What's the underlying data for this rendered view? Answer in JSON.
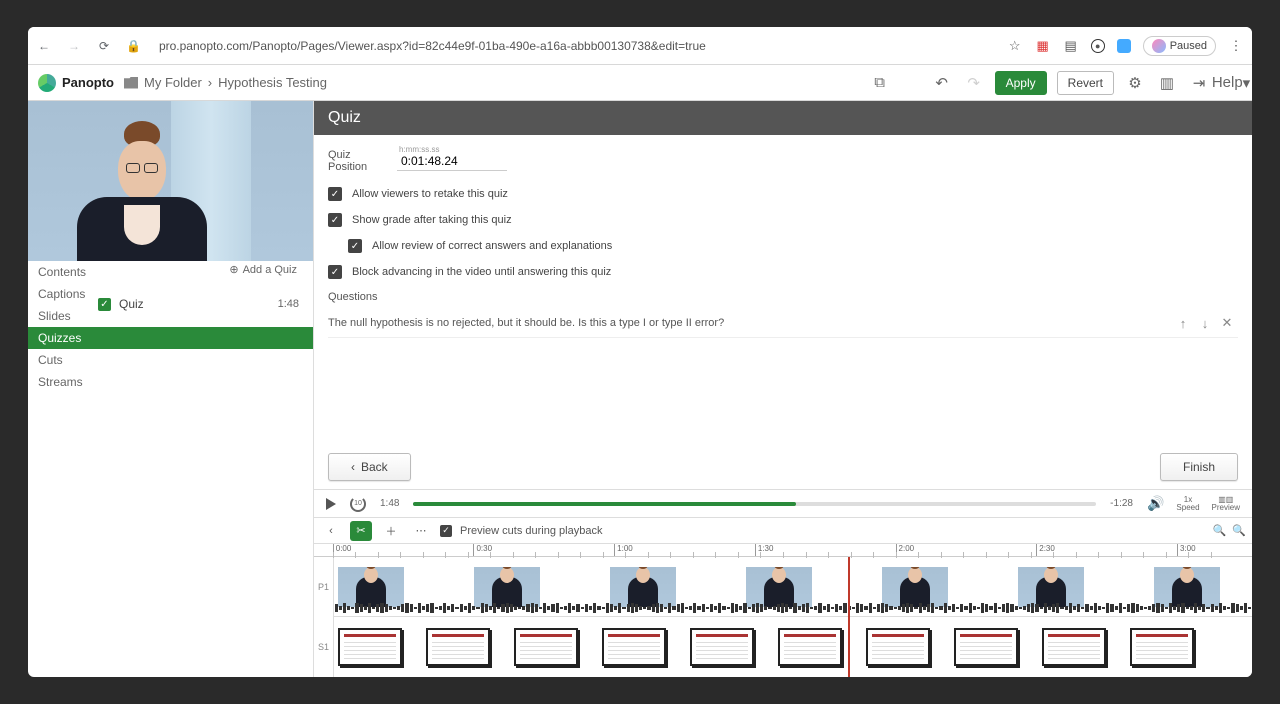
{
  "browser": {
    "url": "pro.panopto.com/Panopto/Pages/Viewer.aspx?id=82c44e9f-01ba-490e-a16a-abbb00130738&edit=true",
    "paused": "Paused"
  },
  "app": {
    "brand": "Panopto",
    "folder": "My Folder",
    "crumb": "Hypothesis Testing",
    "apply": "Apply",
    "revert": "Revert",
    "help": "Help"
  },
  "left": {
    "tabs": [
      "Contents",
      "Captions",
      "Slides",
      "Quizzes",
      "Cuts",
      "Streams"
    ],
    "addquiz": "Add a Quiz",
    "quizitem": {
      "label": "Quiz",
      "time": "1:48"
    }
  },
  "quiz": {
    "title": "Quiz",
    "position_label": "Quiz Position",
    "position_hint": "h:mm:ss.ss",
    "position_value": "0:01:48.24",
    "opt_retake": "Allow viewers to retake this quiz",
    "opt_grade": "Show grade after taking this quiz",
    "opt_review": "Allow review of correct answers and explanations",
    "opt_block": "Block advancing in the video until answering this quiz",
    "questions_hd": "Questions",
    "question1": "The null hypothesis is no rejected, but it should be. Is this a type I or type II error?",
    "back": "Back",
    "finish": "Finish"
  },
  "player": {
    "cur": "1:48",
    "rem": "-1:28",
    "speed": "1x",
    "speed_lbl": "Speed",
    "preview_lbl": "Preview"
  },
  "tltool": {
    "preview_cuts": "Preview cuts during playback"
  },
  "ruler": [
    "0:00",
    "0:30",
    "1:00",
    "1:30",
    "2:00",
    "2:30",
    "3:00"
  ],
  "tracks": {
    "p": "P1",
    "s": "S1"
  }
}
